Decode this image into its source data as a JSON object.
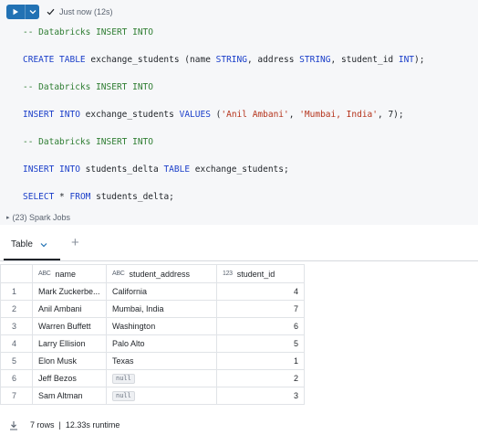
{
  "toolbar": {
    "status_text": "Just now (12s)"
  },
  "code_lines": [
    [
      {
        "t": "-- Databricks INSERT INTO",
        "c": "cm"
      }
    ],
    [
      {
        "t": "CREATE TABLE",
        "c": "kw"
      },
      {
        "t": " exchange_students (name ",
        "c": "id"
      },
      {
        "t": "STRING",
        "c": "kw"
      },
      {
        "t": ", address ",
        "c": "id"
      },
      {
        "t": "STRING",
        "c": "kw"
      },
      {
        "t": ", student_id ",
        "c": "id"
      },
      {
        "t": "INT",
        "c": "kw"
      },
      {
        "t": ");",
        "c": "id"
      }
    ],
    [
      {
        "t": "-- Databricks INSERT INTO",
        "c": "cm"
      }
    ],
    [
      {
        "t": "INSERT INTO",
        "c": "kw"
      },
      {
        "t": " exchange_students ",
        "c": "id"
      },
      {
        "t": "VALUES",
        "c": "kw"
      },
      {
        "t": " (",
        "c": "id"
      },
      {
        "t": "'Anil Ambani'",
        "c": "str"
      },
      {
        "t": ", ",
        "c": "id"
      },
      {
        "t": "'Mumbai, India'",
        "c": "str"
      },
      {
        "t": ", ",
        "c": "id"
      },
      {
        "t": "7",
        "c": "num"
      },
      {
        "t": ");",
        "c": "id"
      }
    ],
    [
      {
        "t": "-- Databricks INSERT INTO",
        "c": "cm"
      }
    ],
    [
      {
        "t": "INSERT INTO",
        "c": "kw"
      },
      {
        "t": " students_delta ",
        "c": "id"
      },
      {
        "t": "TABLE",
        "c": "kw"
      },
      {
        "t": " exchange_students;",
        "c": "id"
      }
    ],
    [
      {
        "t": "SELECT",
        "c": "kw"
      },
      {
        "t": " * ",
        "c": "id"
      },
      {
        "t": "FROM",
        "c": "kw"
      },
      {
        "t": " students_delta;",
        "c": "id"
      }
    ]
  ],
  "spark_jobs": {
    "label": "(23) Spark Jobs"
  },
  "results": {
    "tab_label": "Table",
    "columns": [
      {
        "label": "name",
        "type_icon": "ABC"
      },
      {
        "label": "student_address",
        "type_icon": "ABC"
      },
      {
        "label": "student_id",
        "type_icon": "123"
      }
    ],
    "rows": [
      {
        "n": "1",
        "name": "Mark Zuckerbe...",
        "address": "California",
        "id": "4"
      },
      {
        "n": "2",
        "name": "Anil Ambani",
        "address": "Mumbai, India",
        "id": "7"
      },
      {
        "n": "3",
        "name": "Warren Buffett",
        "address": "Washington",
        "id": "6"
      },
      {
        "n": "4",
        "name": "Larry Ellision",
        "address": "Palo Alto",
        "id": "5"
      },
      {
        "n": "5",
        "name": "Elon Musk",
        "address": "Texas",
        "id": "1"
      },
      {
        "n": "6",
        "name": "Jeff Bezos",
        "address": null,
        "id": "2"
      },
      {
        "n": "7",
        "name": "Sam Altman",
        "address": null,
        "id": "3"
      }
    ],
    "null_label": "null"
  },
  "footer": {
    "rows_text": "7 rows",
    "separator": "|",
    "runtime_text": "12.33s runtime"
  },
  "colors": {
    "accent": "#2272b4",
    "comment": "#2e7d32",
    "keyword": "#1a3ec9",
    "string": "#b5331b"
  }
}
